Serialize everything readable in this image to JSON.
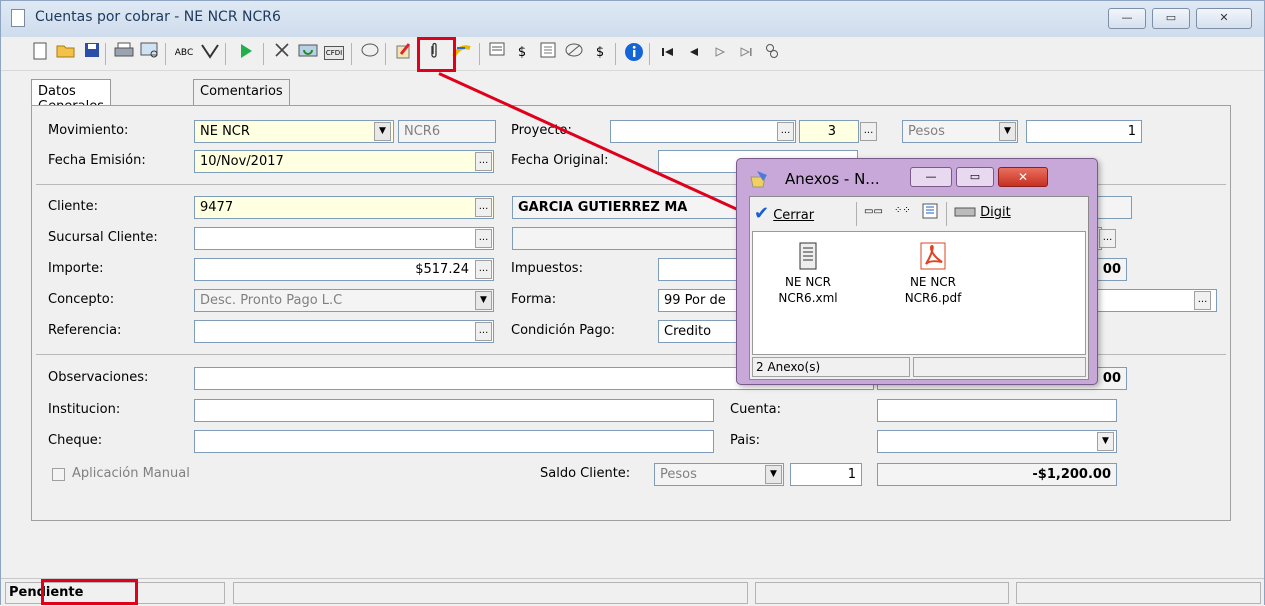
{
  "window": {
    "title": "Cuentas por cobrar - NE NCR NCR6",
    "controls": {
      "minimize": "—",
      "maximize": "▭",
      "close": "✕"
    }
  },
  "toolbar": {
    "icons": [
      "new-icon",
      "open-icon",
      "save-icon",
      "print-icon",
      "preview-icon",
      "spellcheck-icon",
      "filter-icon",
      "run-icon",
      "cancel-icon",
      "refresh-icon",
      "cfdi-icon",
      "link-icon",
      "edit-icon",
      "attach-icon",
      "import-icon",
      "report-icon",
      "money-icon",
      "calculator-icon",
      "discount-icon",
      "payment-icon",
      "info-icon",
      "first-icon",
      "prev-icon",
      "next-icon",
      "last-icon",
      "related-icon"
    ],
    "cfdi_label": "CFDI",
    "spell_label": "ABC"
  },
  "tabs": [
    {
      "label": "Datos Generales",
      "active": true
    },
    {
      "label": "Comentarios",
      "active": false
    }
  ],
  "form": {
    "movimiento": {
      "label": "Movimiento:",
      "value": "NE NCR",
      "code": "NCR6"
    },
    "proyecto": {
      "label": "Proyecto:",
      "value": "",
      "num": "3",
      "moneda": "Pesos",
      "tipo_cambio": "1"
    },
    "fecha_emision": {
      "label": "Fecha Emisión:",
      "value": "10/Nov/2017"
    },
    "fecha_original": {
      "label": "Fecha Original:",
      "value": ""
    },
    "cliente": {
      "label": "Cliente:",
      "value": "9477",
      "nombre": "GARCIA GUTIERREZ MA"
    },
    "sucursal": {
      "label": "Sucursal Cliente:",
      "value": ""
    },
    "importe": {
      "label": "Importe:",
      "value": "$517.24"
    },
    "impuestos": {
      "label": "Impuestos:",
      "value": "",
      "total_suffix": "00"
    },
    "concepto": {
      "label": "Concepto:",
      "value": "Desc. Pronto Pago L.C"
    },
    "forma": {
      "label": "Forma:",
      "value": "99 Por de"
    },
    "referencia": {
      "label": "Referencia:",
      "value": ""
    },
    "condicion": {
      "label": "Condición Pago:",
      "value": "Credito"
    },
    "observaciones": {
      "label": "Observaciones:",
      "value": "",
      "suffix": "00"
    },
    "institucion": {
      "label": "Institucion:",
      "value": ""
    },
    "cuenta": {
      "label": "Cuenta:",
      "value": ""
    },
    "cheque": {
      "label": "Cheque:",
      "value": ""
    },
    "pais": {
      "label": "Pais:",
      "value": ""
    },
    "aplicacion_manual": {
      "label": "Aplicación Manual",
      "checked": false
    },
    "saldo_cliente": {
      "label": "Saldo Cliente:",
      "moneda": "Pesos",
      "tipo_cambio": "1",
      "saldo": "-$1,200.00"
    }
  },
  "status": {
    "estado": "Pendiente"
  },
  "dialog": {
    "title": "Anexos - N...",
    "close_label": "Cerrar",
    "scan_label": "Digit",
    "files": [
      {
        "name_line1": "NE NCR",
        "name_line2": "NCR6.xml",
        "icon": "xml-file-icon"
      },
      {
        "name_line1": "NE NCR",
        "name_line2": "NCR6.pdf",
        "icon": "pdf-file-icon"
      }
    ],
    "count_label": "2 Anexo(s)"
  },
  "colors": {
    "highlight": "#e0001b",
    "required_field": "#ffffe1",
    "dialog_frame": "#c8a8d8"
  }
}
